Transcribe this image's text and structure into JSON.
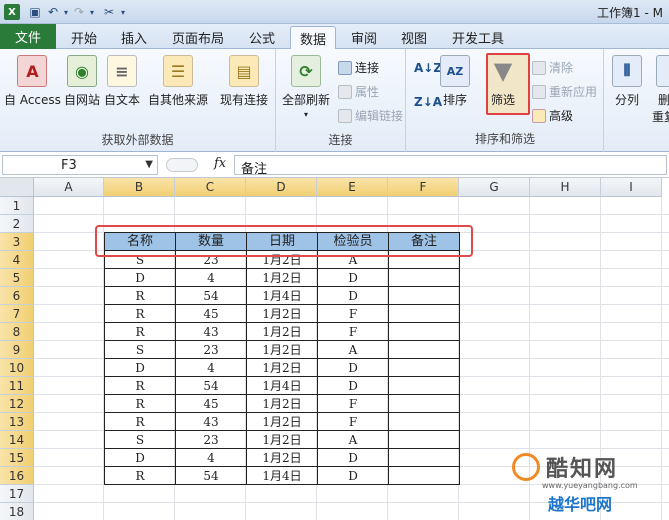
{
  "window": {
    "title": "工作簿1 - M"
  },
  "tabs": [
    "文件",
    "开始",
    "插入",
    "页面布局",
    "公式",
    "数据",
    "审阅",
    "视图",
    "开发工具"
  ],
  "ribbon": {
    "get_external": {
      "label": "获取外部数据",
      "access": "自 Access",
      "web": "自网站",
      "text": "自文本",
      "other": "自其他来源",
      "existing": "现有连接"
    },
    "connections": {
      "label": "连接",
      "refresh_all": "全部刷新",
      "connections": "连接",
      "properties": "属性",
      "edit_links": "编辑链接"
    },
    "sort_filter": {
      "label": "排序和筛选",
      "sort": "排序",
      "filter": "筛选",
      "clear": "清除",
      "reapply": "重新应用",
      "advanced": "高级"
    },
    "tools": {
      "split": "分列",
      "delete_dup": "删",
      "dup": "重复"
    }
  },
  "formula_bar": {
    "name_box": "F3",
    "fx": "fx",
    "content": "备注"
  },
  "sheet": {
    "columns": [
      "A",
      "B",
      "C",
      "D",
      "E",
      "F",
      "G",
      "H",
      "I"
    ],
    "rows": [
      "1",
      "2",
      "3",
      "4",
      "5",
      "6",
      "7",
      "8",
      "9",
      "10",
      "11",
      "12",
      "13",
      "14",
      "15",
      "16",
      "17",
      "18"
    ],
    "table_header": [
      "名称",
      "数量",
      "日期",
      "检验员",
      "备注"
    ],
    "table_rows": [
      [
        "S",
        "23",
        "1月2日",
        "A",
        ""
      ],
      [
        "D",
        "4",
        "1月2日",
        "D",
        ""
      ],
      [
        "R",
        "54",
        "1月4日",
        "D",
        ""
      ],
      [
        "R",
        "45",
        "1月2日",
        "F",
        ""
      ],
      [
        "R",
        "43",
        "1月2日",
        "F",
        ""
      ],
      [
        "S",
        "23",
        "1月2日",
        "A",
        ""
      ],
      [
        "D",
        "4",
        "1月2日",
        "D",
        ""
      ],
      [
        "R",
        "54",
        "1月4日",
        "D",
        ""
      ],
      [
        "R",
        "45",
        "1月2日",
        "F",
        ""
      ],
      [
        "R",
        "43",
        "1月2日",
        "F",
        ""
      ],
      [
        "S",
        "23",
        "1月2日",
        "A",
        ""
      ],
      [
        "D",
        "4",
        "1月2日",
        "D",
        ""
      ],
      [
        "R",
        "54",
        "1月4日",
        "D",
        ""
      ]
    ]
  },
  "watermark": {
    "brand": "酷知网",
    "url": "www.yueyangbang.com",
    "brand2": "越华吧网"
  },
  "colors": {
    "accent_file": "#2a7a3a",
    "header_fill": "#9ec3e6",
    "highlight": "#e04a4a"
  }
}
